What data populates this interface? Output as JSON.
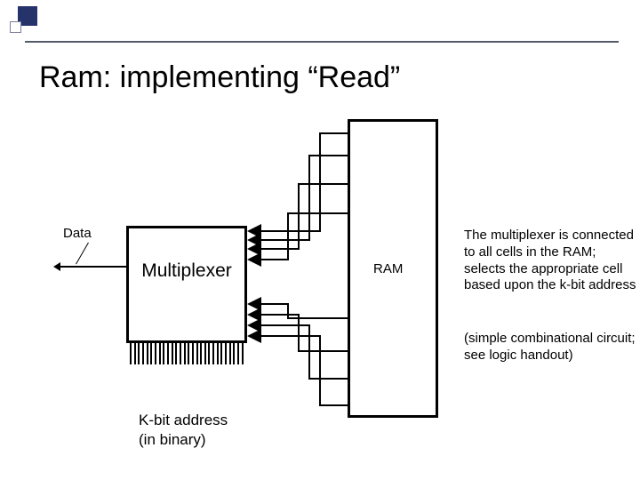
{
  "slide": {
    "title": "Ram: implementing “Read”",
    "data_label": "Data",
    "mux_label": "Multiplexer",
    "ram_label": "RAM",
    "kbit_label_line1": "K-bit address",
    "kbit_label_line2": "(in binary)",
    "rhs_para1": "The multiplexer is connected to all cells in the RAM; selects the appropriate cell based upon the k-bit address",
    "rhs_para2": "(simple combinational circuit; see logic handout)"
  }
}
